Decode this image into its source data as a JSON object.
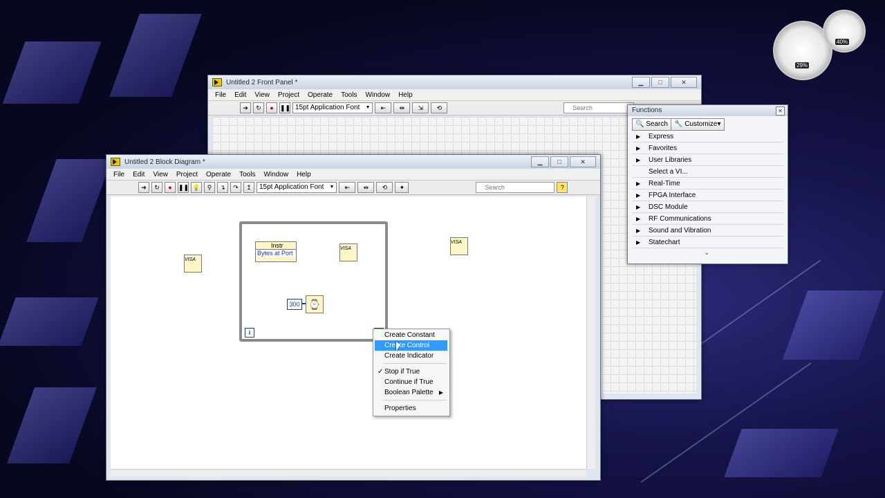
{
  "desktop": {
    "gadget": {
      "cpu_percent": "29%",
      "memory_percent": "40%"
    }
  },
  "front_panel": {
    "title": "Untitled 2 Front Panel *",
    "menus": [
      "File",
      "Edit",
      "View",
      "Project",
      "Operate",
      "Tools",
      "Window",
      "Help"
    ],
    "font_label": "15pt Application Font",
    "search_placeholder": "Search"
  },
  "block_diagram": {
    "title": "Untitled 2 Block Diagram *",
    "menus": [
      "File",
      "Edit",
      "View",
      "Project",
      "Operate",
      "Tools",
      "Window",
      "Help"
    ],
    "font_label": "15pt Application Font",
    "search_placeholder": "Search",
    "nodes": {
      "property_node_title": "Instr",
      "property_node_property": "Bytes at Port",
      "wait_constant": "300",
      "visa_open_label": "VISA",
      "visa_read_label": "VISA",
      "visa_close_label": "VISA",
      "loop_iteration": "i"
    }
  },
  "functions_palette": {
    "title": "Functions",
    "search_label": "Search",
    "customize_label": "Customize▾",
    "items": [
      "Express",
      "Favorites",
      "User Libraries",
      "Select a VI...",
      "Real-Time",
      "FPGA Interface",
      "DSC Module",
      "RF Communications",
      "Sound and Vibration",
      "Statechart"
    ],
    "more_glyph": "⌄"
  },
  "context_menu": {
    "items": [
      "Create Constant",
      "Create Control",
      "Create Indicator",
      "Stop if True",
      "Continue if True",
      "Boolean Palette",
      "Properties"
    ],
    "selected": "Create Control",
    "checked": "Stop if True"
  }
}
